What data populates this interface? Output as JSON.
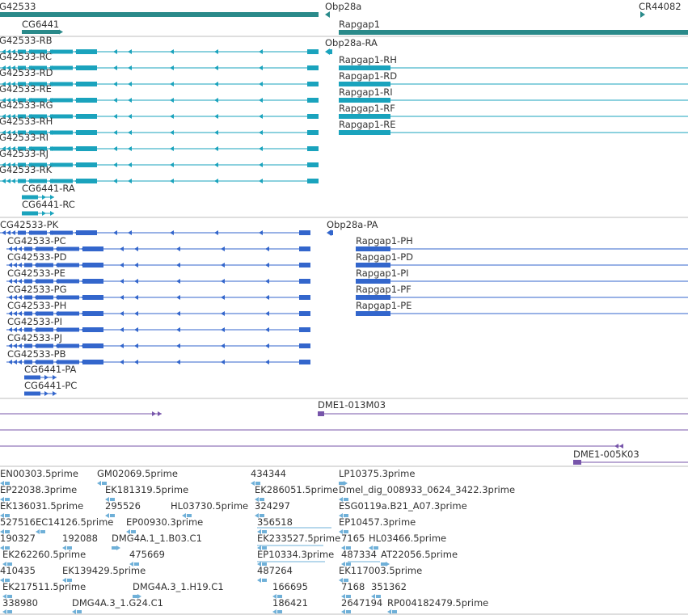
{
  "colors": {
    "gene": "#2a8a8a",
    "transcript_cyan": "#1aa3bd",
    "transcript_blue": "#3366cc",
    "clone": "#7755aa",
    "est": "#6fb0d8",
    "label": "#333333",
    "separator": "#bdbdbd"
  },
  "tracks": {
    "genes": {
      "items": [
        {
          "label": "G42533",
          "dir": "none"
        },
        {
          "label": "Obp28a",
          "dir": "left"
        },
        {
          "label": "CR44082",
          "dir": "right"
        },
        {
          "label": "CG6441",
          "dir": "right"
        },
        {
          "label": "Rapgap1",
          "dir": "none"
        }
      ]
    },
    "transcripts_r": {
      "items": [
        {
          "label": "G42533-RB"
        },
        {
          "label": "G42533-RC"
        },
        {
          "label": "G42533-RD"
        },
        {
          "label": "G42533-RE"
        },
        {
          "label": "G42533-RG"
        },
        {
          "label": "G42533-RH"
        },
        {
          "label": "G42533-RI"
        },
        {
          "label": "G42533-RJ"
        },
        {
          "label": "G42533-RK"
        },
        {
          "label": "CG6441-RA"
        },
        {
          "label": "CG6441-RC"
        },
        {
          "label": "Obp28a-RA"
        },
        {
          "label": "Rapgap1-RH"
        },
        {
          "label": "Rapgap1-RD"
        },
        {
          "label": "Rapgap1-RI"
        },
        {
          "label": "Rapgap1-RF"
        },
        {
          "label": "Rapgap1-RE"
        }
      ]
    },
    "transcripts_p": {
      "items": [
        {
          "label": "CG42533-PK"
        },
        {
          "label": "CG42533-PC"
        },
        {
          "label": "CG42533-PD"
        },
        {
          "label": "CG42533-PE"
        },
        {
          "label": "CG42533-PG"
        },
        {
          "label": "CG42533-PH"
        },
        {
          "label": "CG42533-PI"
        },
        {
          "label": "CG42533-PJ"
        },
        {
          "label": "CG42533-PB"
        },
        {
          "label": "CG6441-PA"
        },
        {
          "label": "CG6441-PC"
        },
        {
          "label": "Obp28a-PA"
        },
        {
          "label": "Rapgap1-PH"
        },
        {
          "label": "Rapgap1-PD"
        },
        {
          "label": "Rapgap1-PI"
        },
        {
          "label": "Rapgap1-PF"
        },
        {
          "label": "Rapgap1-PE"
        }
      ]
    },
    "clones": {
      "items": [
        {
          "label": "DME1-013M03"
        },
        {
          "label": "DME1-005K03"
        }
      ]
    },
    "ests": {
      "items": [
        {
          "label": "EN00303.5prime"
        },
        {
          "label": "GM02069.5prime"
        },
        {
          "label": "434344"
        },
        {
          "label": "LP10375.3prime"
        },
        {
          "label": "EP22038.3prime"
        },
        {
          "label": "EK181319.5prime"
        },
        {
          "label": "EK286051.5prime"
        },
        {
          "label": "Dmel_dig_008933_0624_3422.3prime"
        },
        {
          "label": "EK136031.5prime"
        },
        {
          "label": "295526"
        },
        {
          "label": "HL03730.5prime"
        },
        {
          "label": "324297"
        },
        {
          "label": "ESG0119a.B21_A07.3prime"
        },
        {
          "label": "527516"
        },
        {
          "label": "EC14126.5prime"
        },
        {
          "label": "EP00930.3prime"
        },
        {
          "label": "356518"
        },
        {
          "label": "EP10457.3prime"
        },
        {
          "label": "190327"
        },
        {
          "label": "192088"
        },
        {
          "label": "DMG4A.1_1.B03.C1"
        },
        {
          "label": "EK233527.5prime"
        },
        {
          "label": "7165"
        },
        {
          "label": "HL03466.5prime"
        },
        {
          "label": "EK262260.5prime"
        },
        {
          "label": "475669"
        },
        {
          "label": "EP10334.3prime"
        },
        {
          "label": "487334"
        },
        {
          "label": "AT22056.5prime"
        },
        {
          "label": "410435"
        },
        {
          "label": "EK139429.5prime"
        },
        {
          "label": "487264"
        },
        {
          "label": "EK117003.5prime"
        },
        {
          "label": "EK217511.5prime"
        },
        {
          "label": "DMG4A.3_1.H19.C1"
        },
        {
          "label": "166695"
        },
        {
          "label": "7168"
        },
        {
          "label": "351362"
        },
        {
          "label": "338980"
        },
        {
          "label": "DMG4A.3_1.G24.C1"
        },
        {
          "label": "186421"
        },
        {
          "label": "2647194"
        },
        {
          "label": "RP004182479.5prime"
        }
      ]
    }
  }
}
